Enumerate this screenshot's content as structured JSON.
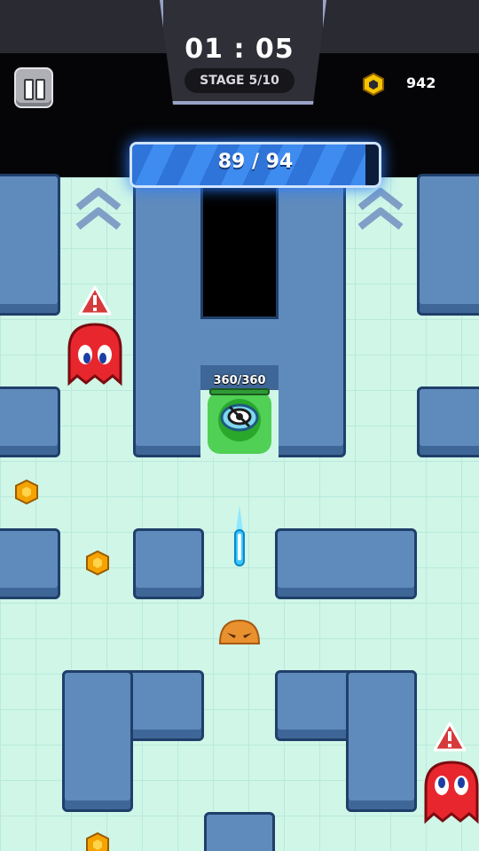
{
  "hud": {
    "timer": "01 : 05",
    "stage": "STAGE 5/10",
    "coins": "942",
    "pause_icon": "pause-icon",
    "coin_icon": "hex-coin-icon"
  },
  "progress": {
    "label": "89 / 94",
    "current": 89,
    "max": 94
  },
  "player": {
    "hp_label": "360/360",
    "hp_fraction": 1.0,
    "icon": "hidden-eye-icon"
  },
  "colors": {
    "floor": "#cff6e7",
    "wall": "#5f8bbc",
    "ghost": "#e8262e",
    "coin": "#f4a300",
    "player_aura": "#39c93a",
    "progress_fill": "#2f74d8"
  }
}
